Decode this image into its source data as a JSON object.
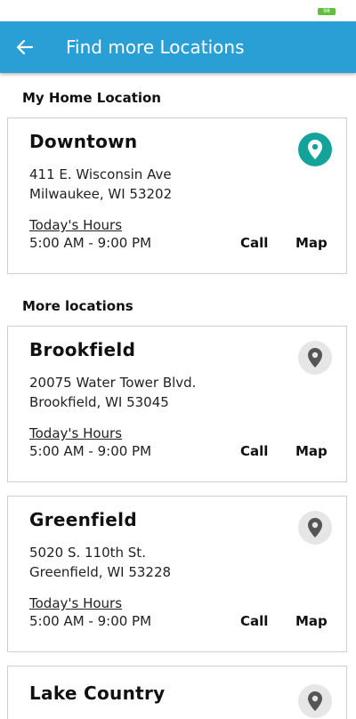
{
  "status_bar": {
    "battery": "98"
  },
  "header": {
    "title": "Find more Locations",
    "back_icon": "arrow-left-icon"
  },
  "colors": {
    "app_bar": "#2a9fd6",
    "home_pin": "#14a39a",
    "other_pin_bg": "#e6e6e6",
    "other_pin": "#555555"
  },
  "home_section": {
    "title": "My Home Location",
    "location": {
      "name": "Downtown",
      "address_line1": "411 E. Wisconsin Ave",
      "address_line2": "Milwaukee, WI 53202",
      "hours_label": "Today's Hours",
      "hours": "5:00 AM - 9:00 PM",
      "call_label": "Call",
      "map_label": "Map",
      "icon": "location-pin-icon"
    }
  },
  "more_section": {
    "title": "More locations",
    "locations": [
      {
        "name": "Brookfield",
        "address_line1": "20075 Water Tower Blvd.",
        "address_line2": "Brookfield, WI 53045",
        "hours_label": "Today's Hours",
        "hours": "5:00 AM - 9:00 PM",
        "call_label": "Call",
        "map_label": "Map",
        "icon": "location-pin-icon"
      },
      {
        "name": "Greenfield",
        "address_line1": "5020 S. 110th St.",
        "address_line2": "Greenfield, WI 53228",
        "hours_label": "Today's Hours",
        "hours": "5:00 AM - 9:00 PM",
        "call_label": "Call",
        "map_label": "Map",
        "icon": "location-pin-icon"
      },
      {
        "name": "Lake Country",
        "icon": "location-pin-icon"
      }
    ]
  }
}
